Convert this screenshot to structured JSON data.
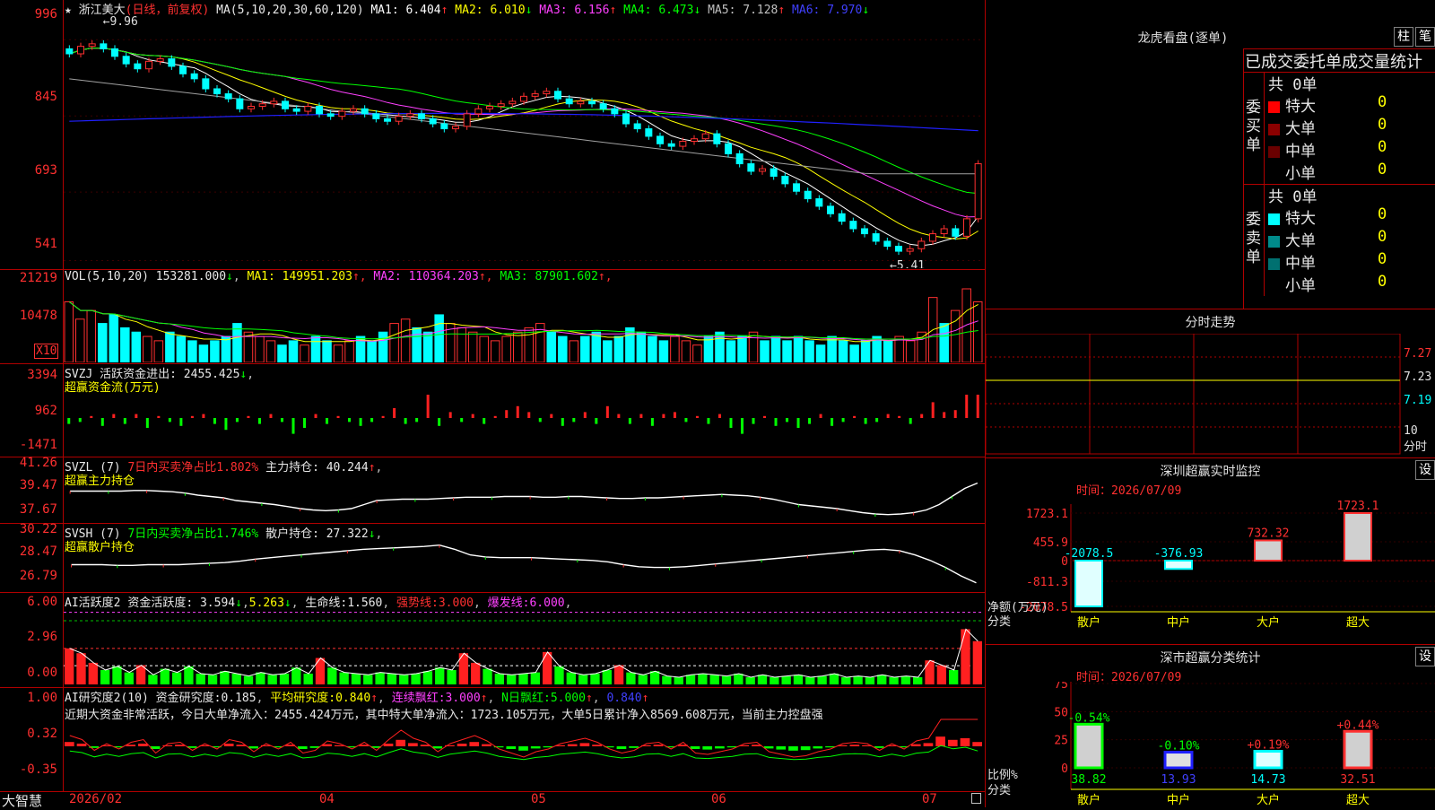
{
  "chart_data": [
    {
      "type": "candlestick",
      "title": "浙江美大",
      "period": "(日线，前复权)",
      "ma_label": "MA(5,10,20,30,60,120)",
      "ma_values": [
        {
          "name": "MA1",
          "value": "6.404",
          "color": "#ffffff"
        },
        {
          "name": "MA2",
          "value": "6.010",
          "color": "#ffff00"
        },
        {
          "name": "MA3",
          "value": "6.156",
          "color": "#ff40ff"
        },
        {
          "name": "MA4",
          "value": "6.473",
          "color": "#00ff00"
        },
        {
          "name": "MA5",
          "value": "7.128",
          "color": "#c0c0c0"
        },
        {
          "name": "MA6",
          "value": "7.970",
          "color": "#4040ff"
        }
      ],
      "y_ticks": [
        "996",
        "845",
        "693",
        "541"
      ],
      "high_label": "9.96",
      "low_label": "5.41",
      "close_series": [
        9.4,
        9.55,
        9.6,
        9.5,
        9.35,
        9.2,
        9.1,
        9.25,
        9.3,
        9.15,
        9.0,
        8.9,
        8.7,
        8.6,
        8.5,
        8.3,
        8.35,
        8.4,
        8.45,
        8.3,
        8.25,
        8.35,
        8.2,
        8.15,
        8.25,
        8.3,
        8.2,
        8.1,
        8.05,
        8.15,
        8.2,
        8.1,
        8.0,
        7.9,
        7.95,
        8.2,
        8.3,
        8.35,
        8.4,
        8.45,
        8.55,
        8.6,
        8.65,
        8.5,
        8.4,
        8.45,
        8.4,
        8.3,
        8.2,
        8.0,
        7.9,
        7.75,
        7.6,
        7.55,
        7.65,
        7.7,
        7.8,
        7.6,
        7.4,
        7.2,
        7.05,
        7.1,
        6.95,
        6.8,
        6.65,
        6.5,
        6.35,
        6.2,
        6.05,
        5.9,
        5.8,
        5.65,
        5.55,
        5.45,
        5.5,
        5.65,
        5.8,
        5.9,
        5.75,
        6.1,
        7.2
      ]
    },
    {
      "type": "bar",
      "title": "VOL(5,10,20)",
      "value": "153281.000",
      "ma": [
        {
          "name": "MA1",
          "value": "149951.203",
          "color": "#ffff00"
        },
        {
          "name": "MA2",
          "value": "110364.203",
          "color": "#ff40ff"
        },
        {
          "name": "MA3",
          "value": "87901.602",
          "color": "#00ff00"
        }
      ],
      "y_ticks": [
        "21219",
        "10478"
      ],
      "unit_label": "X10",
      "values": [
        14,
        10,
        12,
        9,
        11,
        8,
        7,
        6,
        5,
        7,
        6,
        5,
        4,
        5,
        6,
        9,
        7,
        6,
        5,
        4,
        5,
        4,
        6,
        5,
        4,
        5,
        6,
        5,
        7,
        9,
        10,
        8,
        7,
        11,
        9,
        8,
        7,
        6,
        5,
        6,
        7,
        8,
        9,
        7,
        6,
        5,
        6,
        7,
        5,
        6,
        8,
        7,
        6,
        5,
        6,
        5,
        4,
        6,
        7,
        5,
        6,
        7,
        5,
        6,
        5,
        6,
        5,
        4,
        6,
        5,
        4,
        5,
        6,
        5,
        6,
        5,
        7,
        15,
        9,
        12,
        17,
        14
      ]
    },
    {
      "type": "bar",
      "title": "SVZJ",
      "label1": "活跃资金进出:",
      "value": "2455.425",
      "label2": "超赢资金流(万元)",
      "y_ticks": [
        "3394",
        "962",
        "-1471"
      ],
      "values": [
        -0.3,
        -0.2,
        0.1,
        -0.4,
        0.2,
        -0.3,
        0.2,
        -0.5,
        0.1,
        -0.2,
        -0.4,
        0.1,
        0.2,
        -0.3,
        -0.6,
        -0.2,
        0.1,
        -0.3,
        0.2,
        -0.2,
        -0.8,
        -0.5,
        0.2,
        -0.3,
        0.1,
        -0.2,
        -0.4,
        -0.2,
        0.1,
        0.5,
        -0.3,
        -0.2,
        1.6,
        -0.4,
        0.3,
        -0.2,
        0.2,
        -0.3,
        0.1,
        0.4,
        0.6,
        0.3,
        -0.2,
        0.2,
        -0.4,
        -0.2,
        0.3,
        -0.3,
        0.6,
        0.2,
        -0.3,
        0.2,
        -0.4,
        0.2,
        0.3,
        -0.2,
        0.1,
        -0.3,
        0.2,
        -0.5,
        -0.8,
        -0.3,
        0.1,
        -0.4,
        -0.2,
        -0.5,
        -0.3,
        0.2,
        -0.4,
        -0.2,
        0.1,
        -0.3,
        -0.2,
        0.2,
        0.1,
        -0.3,
        0.2,
        0.8,
        0.3,
        0.4,
        1.8,
        1.3
      ]
    },
    {
      "type": "line",
      "title": "SVZL (7)",
      "label1": "7日内买卖净占比1.802%",
      "label2": "主力持仓:",
      "value": "40.244",
      "label3": "超赢主力持仓",
      "y_ticks": [
        "41.26",
        "39.47",
        "37.67"
      ],
      "values": [
        40.0,
        40.0,
        40.0,
        40.0,
        40.0,
        40.05,
        40.05,
        40.0,
        39.95,
        39.85,
        39.7,
        39.6,
        39.5,
        39.3,
        39.2,
        39.1,
        39.0,
        38.85,
        38.7,
        38.6,
        38.55,
        38.6,
        38.7,
        39.0,
        39.3,
        39.35,
        39.4,
        39.4,
        39.4,
        39.45,
        39.5,
        39.55,
        39.55,
        39.55,
        39.6,
        39.6,
        39.6,
        39.55,
        39.55,
        39.6,
        39.6,
        39.55,
        39.5,
        39.45,
        39.45,
        39.5,
        39.5,
        39.55,
        39.6,
        39.65,
        39.7,
        39.75,
        39.7,
        39.65,
        39.55,
        39.4,
        39.2,
        39.0,
        38.9,
        38.8,
        38.7,
        38.55,
        38.4,
        38.3,
        38.25,
        38.3,
        38.4,
        38.6,
        39.0,
        39.6,
        40.2,
        40.6
      ]
    },
    {
      "type": "line",
      "title": "SVSH (7)",
      "label1": "7日内买卖净占比1.746%",
      "label2": "散户持仓:",
      "value": "27.322",
      "label3": "超赢散户持仓",
      "y_ticks": [
        "30.22",
        "28.47",
        "26.79"
      ],
      "values": [
        28.6,
        28.6,
        28.6,
        28.55,
        28.55,
        28.6,
        28.6,
        28.6,
        28.65,
        28.7,
        28.75,
        28.85,
        29.0,
        29.1,
        29.2,
        29.3,
        29.4,
        29.5,
        29.6,
        29.7,
        29.75,
        29.8,
        29.85,
        29.9,
        30.0,
        29.7,
        29.3,
        29.15,
        29.1,
        29.1,
        29.1,
        29.05,
        29.0,
        28.95,
        28.9,
        28.8,
        28.6,
        28.45,
        28.4,
        28.4,
        28.45,
        28.55,
        28.65,
        28.75,
        28.85,
        28.95,
        29.05,
        29.15,
        29.25,
        29.35,
        29.45,
        29.55,
        29.65,
        29.7,
        29.6,
        29.3,
        28.9,
        28.4,
        27.8,
        27.3
      ]
    },
    {
      "type": "bar",
      "title": "AI活跃度2",
      "label1": "资金活跃度:",
      "value1": "3.594",
      "value2": "5.263",
      "label2": "生命线:",
      "value3": "1.560",
      "strong_line": "强势线:3.000",
      "burst_line": "爆发线:6.000",
      "y_ticks": [
        "6.00",
        "2.96",
        "0.00"
      ],
      "values": [
        3,
        2.6,
        1.8,
        1.2,
        1.5,
        1.0,
        1.6,
        0.8,
        1.3,
        1.0,
        1.5,
        0.9,
        0.8,
        1.1,
        0.9,
        0.7,
        1.0,
        0.8,
        0.9,
        1.4,
        0.9,
        2.2,
        1.4,
        1.0,
        0.9,
        0.8,
        1.0,
        0.9,
        0.8,
        0.9,
        1.1,
        1.4,
        1.2,
        2.6,
        1.8,
        1.3,
        0.9,
        0.8,
        0.9,
        1.0,
        2.7,
        1.5,
        1.0,
        0.8,
        0.9,
        1.2,
        1.6,
        1.0,
        0.8,
        1.1,
        0.7,
        0.6,
        0.8,
        0.9,
        0.8,
        0.7,
        0.9,
        0.6,
        0.8,
        0.6,
        0.7,
        0.8,
        0.6,
        0.7,
        0.9,
        0.6,
        0.7,
        0.6,
        0.8,
        0.6,
        0.7,
        0.6,
        2.0,
        1.6,
        1.2,
        4.6,
        3.6
      ]
    },
    {
      "type": "bar",
      "title": "AI研究度2(10)",
      "label1": "资金研究度:",
      "value1": "0.185",
      "label2": "平均研究度:",
      "value2": "0.840",
      "label3": "连续飘红:",
      "value3": "3.000",
      "label4": "N日飘红:",
      "value4": "5.000",
      "value5": "0.840",
      "summary": "近期大资金非常活跃，今日大单净流入：2455.424万元，其中特大单净流入：1723.105万元，大单5日累计净入8569.608万元，当前主力控盘强",
      "y_ticks": [
        "1.00",
        "0.32",
        "-0.35"
      ],
      "values": [
        0.08,
        0.05,
        -0.03,
        0.02,
        -0.02,
        0.03,
        0.05,
        -0.05,
        0.02,
        0.03,
        -0.03,
        0.02,
        -0.02,
        0.05,
        0.03,
        -0.04,
        0.02,
        -0.02,
        0.03,
        -0.05,
        -0.03,
        0.04,
        0.02,
        -0.02,
        0.03,
        -0.03,
        0.05,
        0.12,
        0.06,
        0.03,
        -0.04,
        0.02,
        0.05,
        0.08,
        0.04,
        -0.02,
        -0.05,
        -0.08,
        -0.04,
        -0.02,
        0.02,
        0.04,
        0.06,
        0.03,
        -0.02,
        -0.05,
        -0.03,
        0.02,
        0.03,
        -0.02,
        0.03,
        -0.05,
        -0.06,
        -0.04,
        -0.02,
        0.02,
        0.03,
        -0.04,
        -0.06,
        -0.08,
        -0.07,
        -0.04,
        -0.02,
        0.02,
        0.03,
        0.02,
        -0.03,
        0.02,
        -0.02,
        0.04,
        0.06,
        0.18,
        0.12,
        0.15,
        0.08
      ]
    }
  ],
  "x_axis": {
    "start": "2026/02",
    "labels": [
      "04",
      "05",
      "06",
      "07"
    ]
  },
  "logo": "大智慧",
  "right": {
    "dragon_tiger": {
      "title": "龙虎看盘(逐单)",
      "btn1": "柱",
      "btn2": "笔",
      "subtitle": "已成交委托单成交量统计"
    },
    "buy": {
      "side_label": "委买单",
      "total": "共 0单",
      "rows": [
        {
          "label": "特大",
          "value": "0",
          "color": "#ff0000"
        },
        {
          "label": "大单",
          "value": "0",
          "color": "#8b0000"
        },
        {
          "label": "中单",
          "value": "0",
          "color": "#6a0000"
        },
        {
          "label": "小单",
          "value": "0",
          "color": "#000000"
        }
      ]
    },
    "sell": {
      "side_label": "委卖单",
      "total": "共 0单",
      "rows": [
        {
          "label": "特大",
          "value": "0",
          "color": "#00ffff"
        },
        {
          "label": "大单",
          "value": "0",
          "color": "#008b8b"
        },
        {
          "label": "中单",
          "value": "0",
          "color": "#007070"
        },
        {
          "label": "小单",
          "value": "0",
          "color": "#000000"
        }
      ]
    },
    "intraday": {
      "title": "分时走势",
      "y_ticks": [
        "7.27",
        "7.23",
        "7.19"
      ],
      "corner_top": "10",
      "corner_bottom": "分时"
    },
    "monitor": {
      "title": "深圳超赢实时监控",
      "btn": "设",
      "time": "时间：2026/07/09",
      "y_ticks": [
        "1723.1",
        "455.9",
        "0",
        "-811.3",
        "-2078.5"
      ],
      "side_label1": "净额(万元)",
      "side_label2": "分类",
      "categories": [
        "散户",
        "中户",
        "大户",
        "超大"
      ],
      "values": [
        -2078.5,
        -376.93,
        732.32,
        1723.1
      ],
      "value_labels": [
        "-2078.5",
        "-376.93",
        "732.32",
        "1723.1"
      ]
    },
    "classify": {
      "title": "深市超赢分类统计",
      "btn": "设",
      "time": "时间：2026/07/09",
      "y_ticks": [
        "75",
        "50",
        "25",
        "0"
      ],
      "side_label1": "比例%",
      "side_label2": "分类",
      "categories": [
        "散户",
        "中户",
        "大户",
        "超大"
      ],
      "values": [
        38.82,
        13.93,
        14.73,
        32.51
      ],
      "value_labels": [
        "38.82",
        "13.93",
        "14.73",
        "32.51"
      ],
      "changes": [
        "-0.54%",
        "-0.10%",
        "+0.19%",
        "+0.44%"
      ]
    }
  }
}
